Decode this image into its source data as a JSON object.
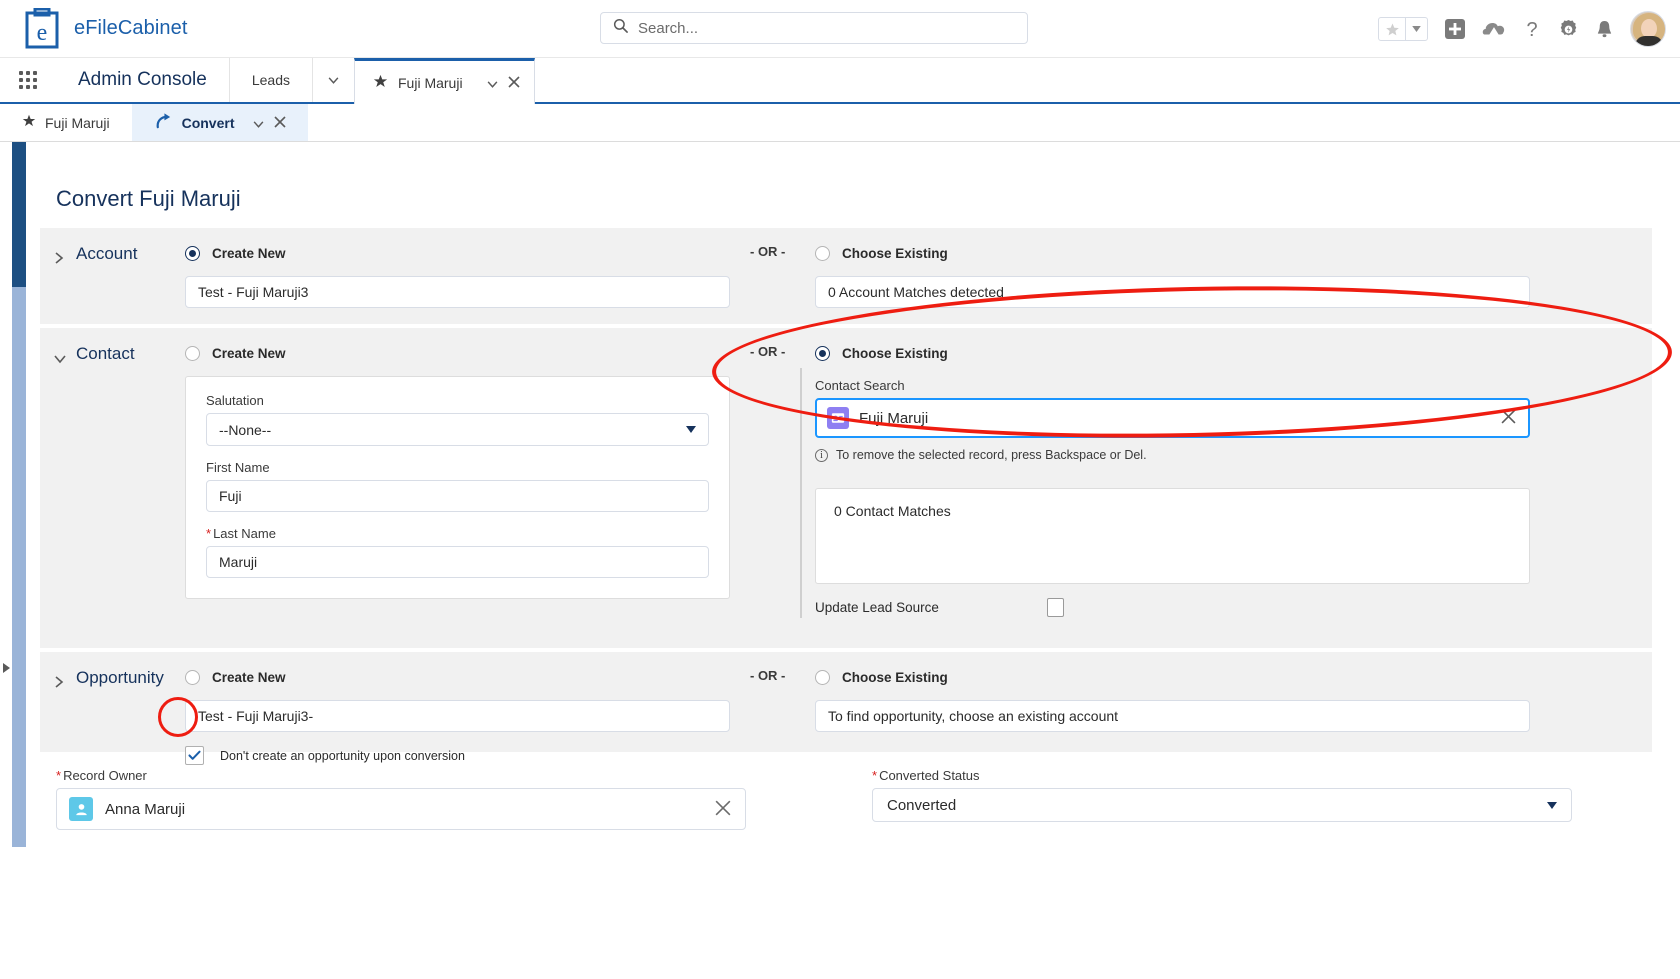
{
  "header": {
    "brand": "eFileCabinet",
    "search_placeholder": "Search...",
    "icons": {
      "search": "search-icon",
      "favorite": "star-icon",
      "favorite_caret": "chevron-down-icon",
      "add": "plus-icon",
      "cloud": "cloud-app-icon",
      "help": "question-mark-icon",
      "setup": "gear-icon",
      "notifications": "bell-icon",
      "avatar": "user-avatar"
    }
  },
  "appnav": {
    "waffle": "app-launcher-icon",
    "app_name": "Admin Console",
    "tabs": [
      {
        "label": "Leads",
        "active": false,
        "icon": ""
      },
      {
        "label": "Fuji Maruji",
        "active": true,
        "icon": "lead-star-icon"
      }
    ],
    "nav_caret": "chevron-down-icon",
    "tab_caret": "chevron-down-icon",
    "tab_close": "close-icon"
  },
  "subtabs": [
    {
      "label": "Fuji Maruji",
      "icon": "lead-star-icon",
      "active": false
    },
    {
      "label": "Convert",
      "icon": "convert-arrow-icon",
      "active": true,
      "caret": "chevron-down-icon",
      "close": "close-icon"
    }
  ],
  "page": {
    "title": "Convert Fuji Maruji",
    "or_divider": "- OR -"
  },
  "account": {
    "section_label": "Account",
    "expanded": false,
    "chevron": "chevron-right-icon",
    "create_new_label": "Create New",
    "create_new_selected": true,
    "account_name_value": "Test - Fuji Maruji3",
    "choose_existing_label": "Choose Existing",
    "choose_existing_selected": false,
    "matches_text": "0 Account Matches detected"
  },
  "contact": {
    "section_label": "Contact",
    "expanded": true,
    "chevron": "chevron-down-icon",
    "create_new_label": "Create New",
    "create_new_selected": false,
    "salutation_label": "Salutation",
    "salutation_value": "--None--",
    "first_name_label": "First Name",
    "first_name_value": "Fuji",
    "last_name_label": "Last Name",
    "last_name_value": "Maruji",
    "last_name_required": "*",
    "choose_existing_label": "Choose Existing",
    "choose_existing_selected": true,
    "contact_search_label": "Contact Search",
    "contact_search_value": "Fuji Maruji",
    "contact_search_icon": "contact-card-icon",
    "contact_search_clear": "close-icon",
    "hint_text": "To remove the selected record, press Backspace or Del.",
    "hint_icon": "info-icon",
    "matches_text": "0 Contact Matches",
    "update_lead_source_label": "Update Lead Source",
    "update_lead_source_checked": false
  },
  "opportunity": {
    "section_label": "Opportunity",
    "expanded": false,
    "chevron": "chevron-right-icon",
    "create_new_label": "Create New",
    "create_new_selected": false,
    "opportunity_name_value": "Test - Fuji Maruji3-",
    "dont_create_label": "Don't create an opportunity upon conversion",
    "dont_create_checked": true,
    "choose_existing_label": "Choose Existing",
    "choose_existing_selected": false,
    "existing_hint": "To find opportunity, choose an existing account"
  },
  "footer_fields": {
    "record_owner_label": "Record Owner",
    "record_owner_required": "*",
    "record_owner_value": "Anna Maruji",
    "record_owner_icon": "user-icon",
    "record_owner_clear": "close-icon",
    "converted_status_label": "Converted Status",
    "converted_status_required": "*",
    "converted_status_value": "Converted",
    "converted_status_caret": "chevron-down-icon"
  },
  "annotations": {
    "accent_color": "#ee1d11",
    "contact_highlight": "ellipse-around-choose-existing-contact",
    "checkbox_highlight": "circle-around-dont-create-opportunity-checkbox"
  },
  "colors": {
    "brand_blue": "#1b5faa",
    "header_navy": "#16325c",
    "section_bg": "#f1f1f1",
    "focus_blue": "#1b96ff",
    "required_red": "#d7201f"
  }
}
